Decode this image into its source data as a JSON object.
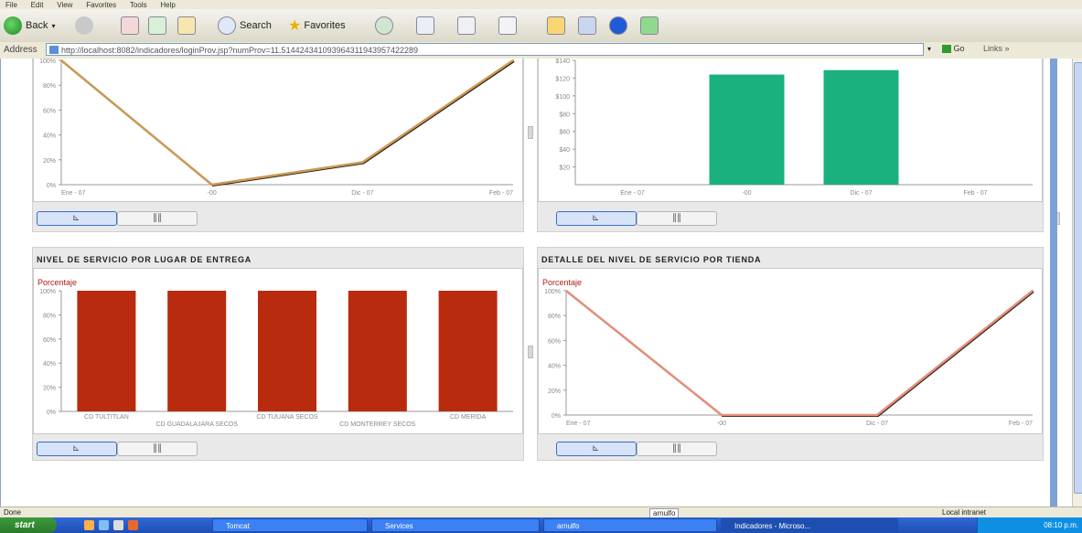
{
  "browser": {
    "menu": [
      "File",
      "Edit",
      "View",
      "Favorites",
      "Tools",
      "Help"
    ],
    "toolbar": {
      "back": "Back",
      "search": "Search",
      "favorites": "Favorites"
    },
    "address": {
      "label": "Address",
      "url": "http://localhost:8082/indicadores/loginProv.jsp?numProv=11.514424341093964311943957422289",
      "go": "Go",
      "links": "Links"
    },
    "status": {
      "left": "Done",
      "user": "arnulfo",
      "zone": "Local intranet"
    }
  },
  "panels": {
    "top_left": {
      "title": ""
    },
    "top_right": {
      "title": ""
    },
    "bottom_left": {
      "title": "NIVEL DE SERVICIO POR LUGAR DE ENTREGA"
    },
    "bottom_right": {
      "title": "DETALLE DEL NIVEL DE SERVICIO POR TIENDA"
    }
  },
  "chart_data": [
    {
      "type": "line",
      "x": [
        "Ene - 07",
        "-00",
        "Dic - 07",
        "Feb - 07"
      ],
      "y_ticks": [
        "0%",
        "20%",
        "40%",
        "60%",
        "80%",
        "100%"
      ],
      "ylim": [
        0,
        100
      ],
      "series": [
        {
          "values": [
            100,
            0,
            18,
            100
          ]
        }
      ],
      "color": "#c99a57"
    },
    {
      "type": "bar",
      "categories": [
        "Ene - 07",
        "-00",
        "Dic - 07",
        "Feb - 07"
      ],
      "y_ticks": [
        "$20",
        "$40",
        "$60",
        "$80",
        "$100",
        "$120",
        "$140"
      ],
      "ylim": [
        0,
        140
      ],
      "values": [
        0,
        124,
        129,
        0
      ],
      "color": "#1ab17f"
    },
    {
      "type": "bar",
      "ylabel": "Porcentaje",
      "categories": [
        "CD TULTITLAN",
        "CD GUADALAJARA SECOS",
        "CD TIJUANA SECOS",
        "CD MONTERREY SECOS",
        "CD MERIDA"
      ],
      "y_ticks": [
        "0%",
        "20%",
        "40%",
        "60%",
        "80%",
        "100%"
      ],
      "ylim": [
        0,
        100
      ],
      "values": [
        100,
        100,
        100,
        100,
        100
      ],
      "color": "#b82b0e"
    },
    {
      "type": "line",
      "ylabel": "Porcentaje",
      "x": [
        "Ene - 07",
        "-00",
        "Dic - 07",
        "Feb - 07"
      ],
      "y_ticks": [
        "0%",
        "20%",
        "40%",
        "60%",
        "80%",
        "100%"
      ],
      "ylim": [
        0,
        100
      ],
      "series": [
        {
          "values": [
            100,
            0,
            0,
            100
          ]
        }
      ],
      "color": "#e58f7b"
    }
  ],
  "taskbar": {
    "start": "start",
    "tasks": [
      "Tomcat",
      "Services",
      "arnulfo",
      "Indicadores - Microso..."
    ],
    "clock": "08:10 p.m."
  }
}
